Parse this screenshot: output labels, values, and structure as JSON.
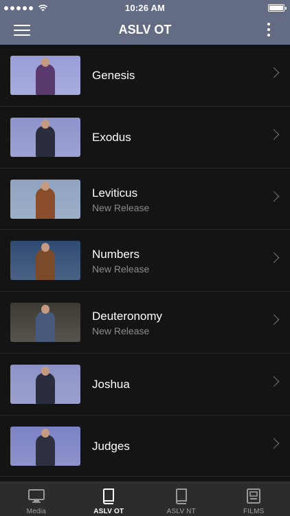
{
  "status": {
    "time": "10:26 AM"
  },
  "header": {
    "title": "ASLV OT"
  },
  "books": [
    {
      "title": "Genesis",
      "subtitle": "",
      "thumb_bg": "#9a9ed8",
      "thumb_fg": "#5a3a6e"
    },
    {
      "title": "Exodus",
      "subtitle": "",
      "thumb_bg": "#8e93cc",
      "thumb_fg": "#2a2d3e"
    },
    {
      "title": "Leviticus",
      "subtitle": "New Release",
      "thumb_bg": "#8fa3c0",
      "thumb_fg": "#8a4e2c"
    },
    {
      "title": "Numbers",
      "subtitle": "New Release",
      "thumb_bg": "#2f4a72",
      "thumb_fg": "#7a4a2a"
    },
    {
      "title": "Deuteronomy",
      "subtitle": "New Release",
      "thumb_bg": "#3c3a32",
      "thumb_fg": "#46597a"
    },
    {
      "title": "Joshua",
      "subtitle": "",
      "thumb_bg": "#8c92c6",
      "thumb_fg": "#2a2d3e"
    },
    {
      "title": "Judges",
      "subtitle": "",
      "thumb_bg": "#7c82c4",
      "thumb_fg": "#2e3140"
    }
  ],
  "tabs": [
    {
      "label": "Media",
      "icon": "monitor-icon",
      "active": false
    },
    {
      "label": "ASLV OT",
      "icon": "book-icon",
      "active": true
    },
    {
      "label": "ASLV NT",
      "icon": "book-icon",
      "active": false
    },
    {
      "label": "FILMS",
      "icon": "film-icon",
      "active": false
    }
  ],
  "colors": {
    "nav_bg": "#636c83",
    "list_bg": "#141414",
    "tab_bg": "#2c2c2e",
    "subtitle": "#8c8c8c"
  }
}
